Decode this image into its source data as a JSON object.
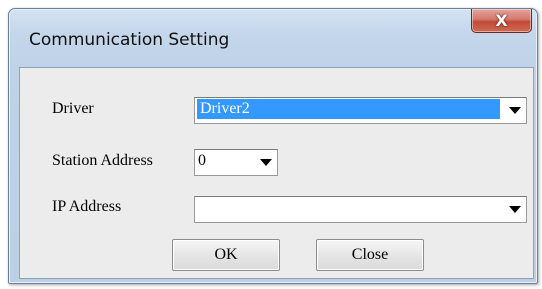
{
  "window": {
    "title": "Communication Setting",
    "close_glyph": "X",
    "close_icon": "close-icon"
  },
  "form": {
    "driver": {
      "label": "Driver",
      "value": "Driver2",
      "dropdown_icon": "chevron-down-icon"
    },
    "station_address": {
      "label": "Station Address",
      "value": "0",
      "dropdown_icon": "chevron-down-icon"
    },
    "ip_address": {
      "label": "IP Address",
      "value": "",
      "dropdown_icon": "chevron-down-icon"
    }
  },
  "buttons": {
    "ok_label": "OK",
    "close_label": "Close"
  },
  "colors": {
    "selection": "#3399ff",
    "title_bar": "#c4d6ea",
    "close_button": "#c14a38"
  }
}
